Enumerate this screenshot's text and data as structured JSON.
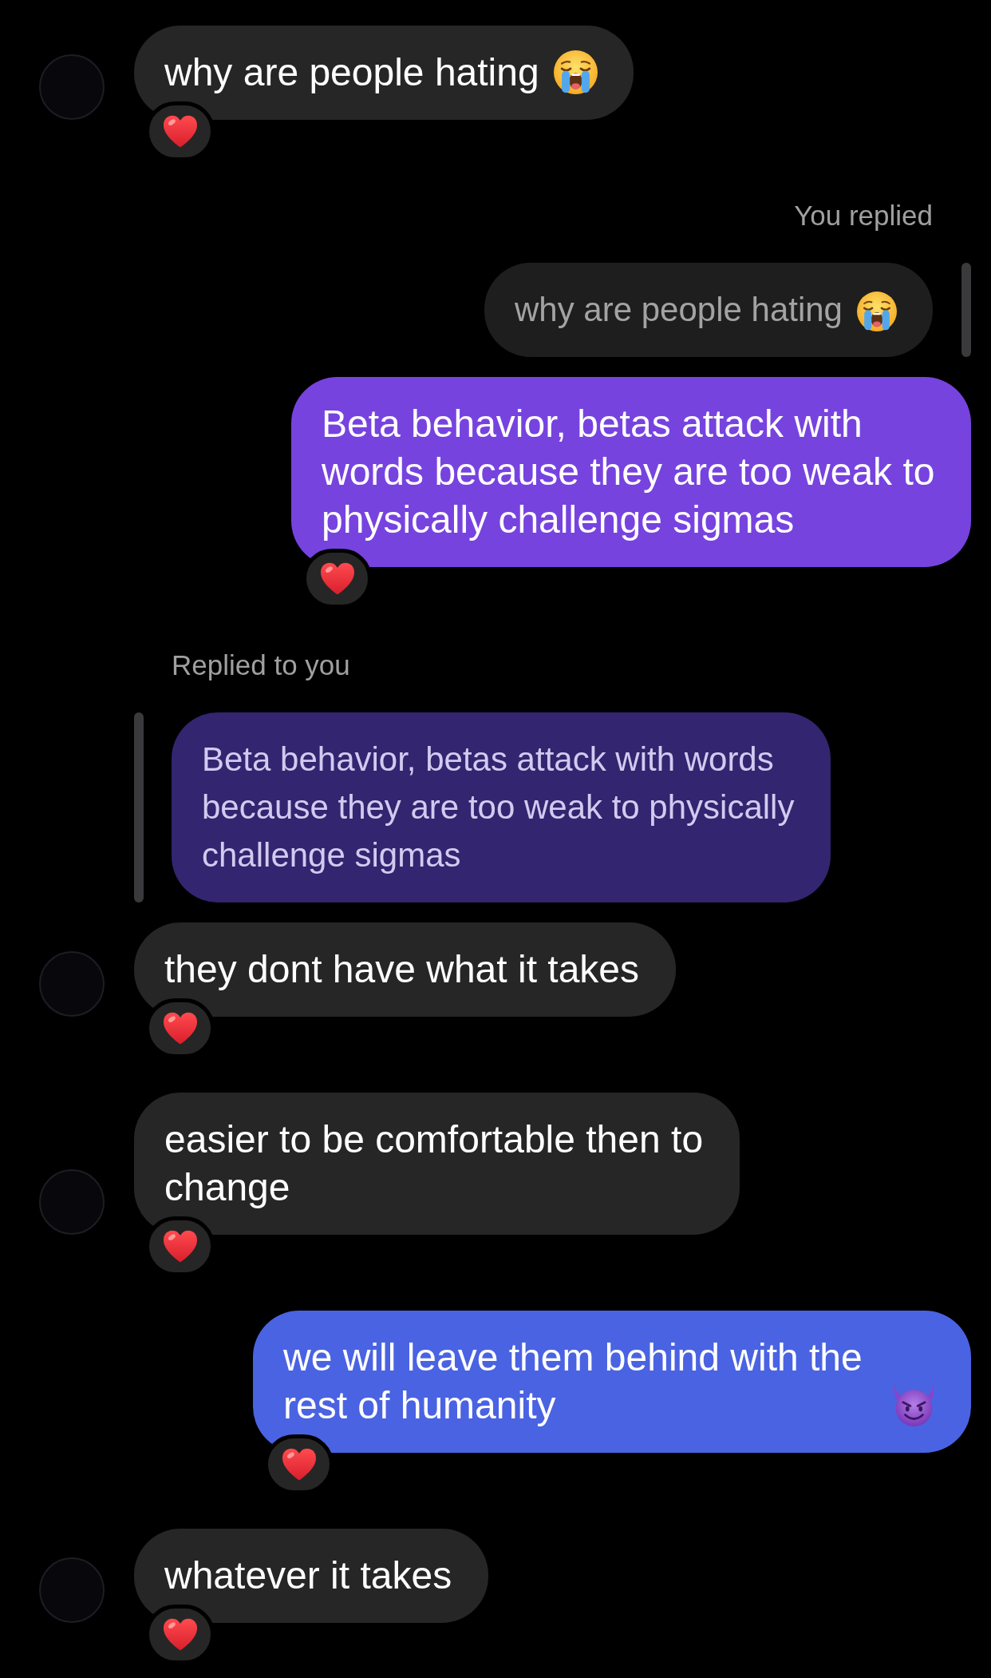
{
  "messages": [
    {
      "kind": "received",
      "text": "why are people hating",
      "emoji": {
        "kind": "crying"
      },
      "reaction": {
        "kind": "heart"
      }
    },
    {
      "kind": "sent",
      "reply": {
        "label": "You replied",
        "text": "why are people hating",
        "emoji": {
          "kind": "crying"
        },
        "color": "#1e1e1e"
      },
      "text": "Beta behavior, betas attack with words because they are too weak to physically challenge sigmas",
      "color": "#7743df",
      "reaction": {
        "kind": "heart"
      }
    },
    {
      "kind": "received",
      "reply": {
        "label": "Replied to you",
        "text": "Beta behavior, betas attack with words because they are too weak to physically challenge sigmas",
        "color": "#33256f"
      },
      "text": "they dont have what it takes",
      "reaction": {
        "kind": "heart"
      }
    },
    {
      "kind": "received",
      "text": "easier to be comfortable then to change",
      "reaction": {
        "kind": "heart"
      }
    },
    {
      "kind": "sent",
      "text": "we will leave them behind with the rest of humanity",
      "emoji": {
        "kind": "devil"
      },
      "color": "#4a63e2",
      "reaction": {
        "kind": "heart"
      }
    },
    {
      "kind": "received",
      "text": "whatever it takes",
      "reaction": {
        "kind": "heart"
      }
    }
  ]
}
